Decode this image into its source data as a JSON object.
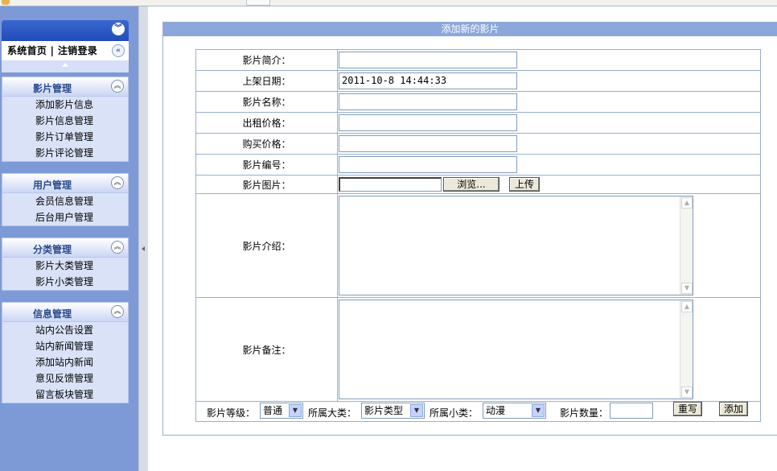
{
  "sidebar": {
    "top_links": "系统首页 | 注销登录",
    "groups": [
      {
        "title": "影片管理",
        "items": [
          "添加影片信息",
          "影片信息管理",
          "影片订单管理",
          "影片评论管理"
        ]
      },
      {
        "title": "用户管理",
        "items": [
          "会员信息管理",
          "后台用户管理"
        ]
      },
      {
        "title": "分类管理",
        "items": [
          "影片大类管理",
          "影片小类管理"
        ]
      },
      {
        "title": "信息管理",
        "items": [
          "站内公告设置",
          "站内新闻管理",
          "添加站内新闻",
          "意见反馈管理",
          "留言板块管理"
        ]
      }
    ]
  },
  "form": {
    "header": "添加新的影片",
    "fields": {
      "brief": {
        "label": "影片简介：",
        "value": ""
      },
      "date": {
        "label": "上架日期：",
        "value": "2011-10-8 14:44:33"
      },
      "name": {
        "label": "影片名称：",
        "value": ""
      },
      "rent": {
        "label": "出租价格：",
        "value": ""
      },
      "buy": {
        "label": "购买价格：",
        "value": ""
      },
      "code": {
        "label": "影片编号：",
        "value": ""
      },
      "image": {
        "label": "影片图片：",
        "browse": "浏览...",
        "upload": "上传"
      },
      "intro": {
        "label": "影片介绍："
      },
      "note": {
        "label": "影片备注："
      }
    },
    "bottom": {
      "level_label": "影片等级：",
      "level_value": "普通",
      "major_label": "所属大类：",
      "major_value": "影片类型",
      "minor_label": "所属小类：",
      "minor_value": "动漫",
      "count_label": "影片数量：",
      "reset": "重写",
      "add": "添加"
    }
  }
}
